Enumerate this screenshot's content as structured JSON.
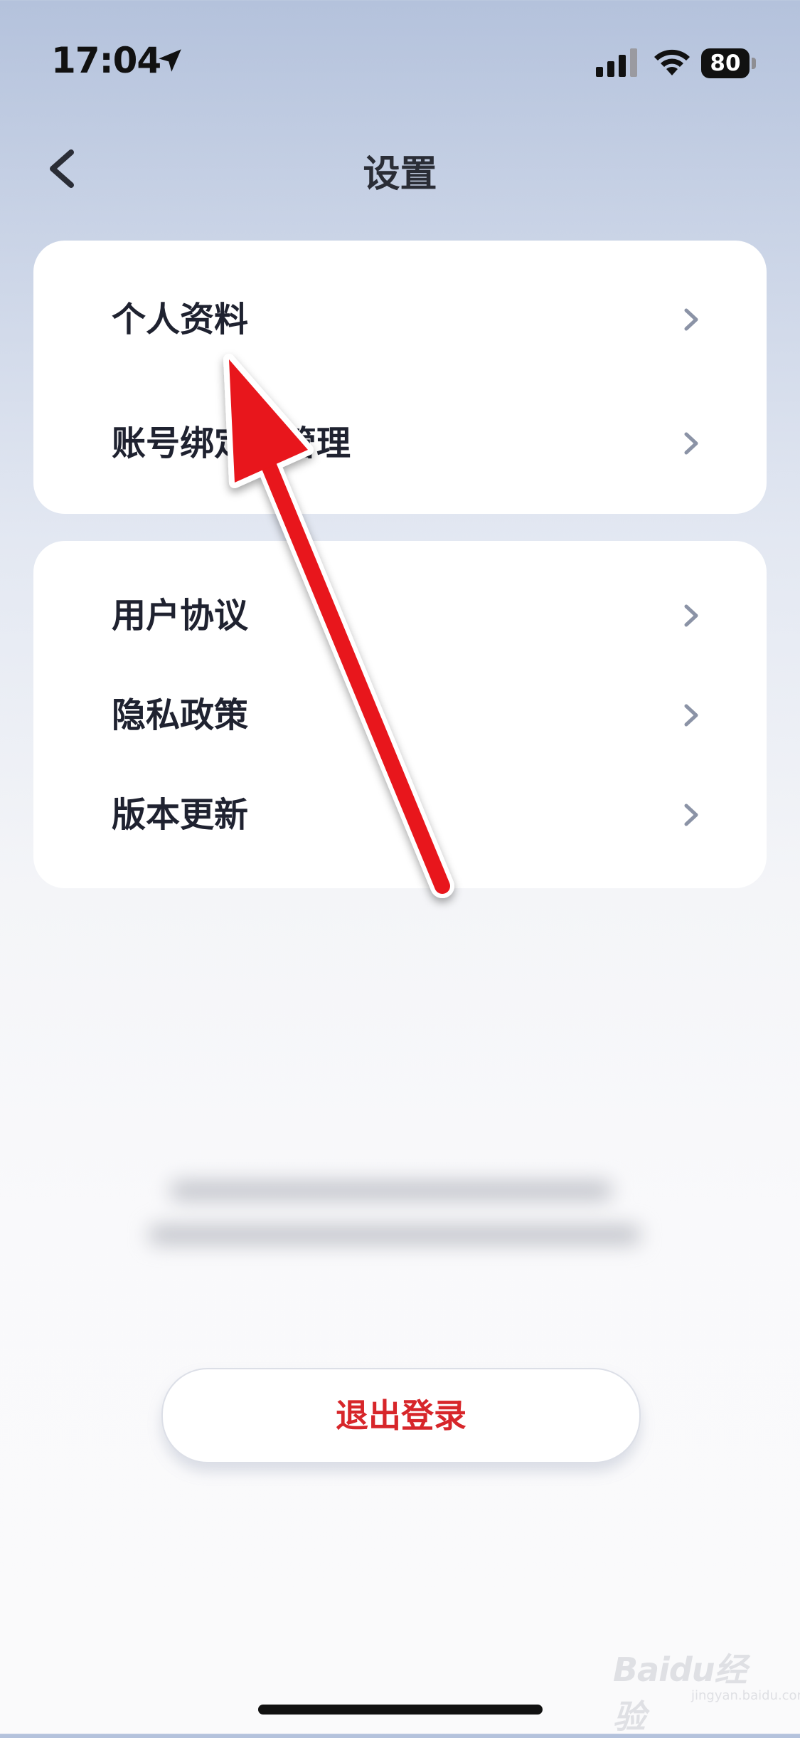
{
  "status_bar": {
    "time": "17:04",
    "battery": "80",
    "icons": [
      "location-arrow-icon",
      "cellular-signal-icon",
      "wifi-icon",
      "battery-icon"
    ]
  },
  "nav": {
    "back_icon": "chevron-left-icon",
    "title": "设置"
  },
  "groups": [
    {
      "items": [
        {
          "label": "个人资料"
        },
        {
          "label": "账号绑定与管理"
        }
      ]
    },
    {
      "items": [
        {
          "label": "用户协议"
        },
        {
          "label": "隐私政策"
        },
        {
          "label": "版本更新"
        }
      ]
    }
  ],
  "row_chevron_icon": "chevron-right-icon",
  "logout_label": "退出登录",
  "watermark": {
    "text": "Baidu经验",
    "sub": "jingyan.baidu.com"
  },
  "colors": {
    "annotation_arrow": "#e8141a",
    "logout_text": "#d7262a",
    "chevron": "#8b93a6"
  }
}
